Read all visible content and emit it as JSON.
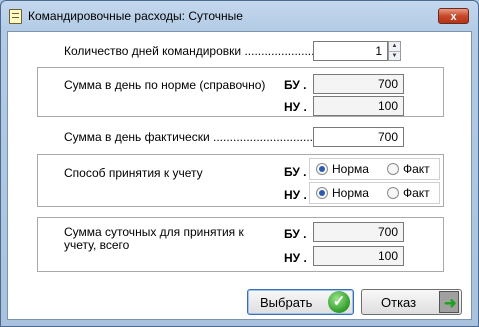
{
  "window": {
    "title": "Командировочные расходы: Суточные",
    "close_label": "x"
  },
  "days": {
    "label": "Количество дней командировки ............................",
    "value": "1"
  },
  "norm": {
    "label": "Сумма в день по норме (справочно)",
    "bu_tag": "БУ .",
    "bu_value": "700",
    "nu_tag": "НУ .",
    "nu_value": "100"
  },
  "actual": {
    "label": "Сумма в день фактически .................................",
    "value": "700"
  },
  "method": {
    "label": "Способ принятия к учету",
    "bu_tag": "БУ .",
    "nu_tag": "НУ .",
    "opt_norm": "Норма",
    "opt_fact": "Факт",
    "bu_selected": "norm",
    "nu_selected": "norm"
  },
  "total": {
    "label_line1": "Сумма суточных для принятия к",
    "label_line2": "учету, всего",
    "bu_tag": "БУ .",
    "bu_value": "700",
    "nu_tag": "НУ .",
    "nu_value": "100"
  },
  "buttons": {
    "select_label": "Выбрать",
    "cancel_label": "Отказ"
  }
}
